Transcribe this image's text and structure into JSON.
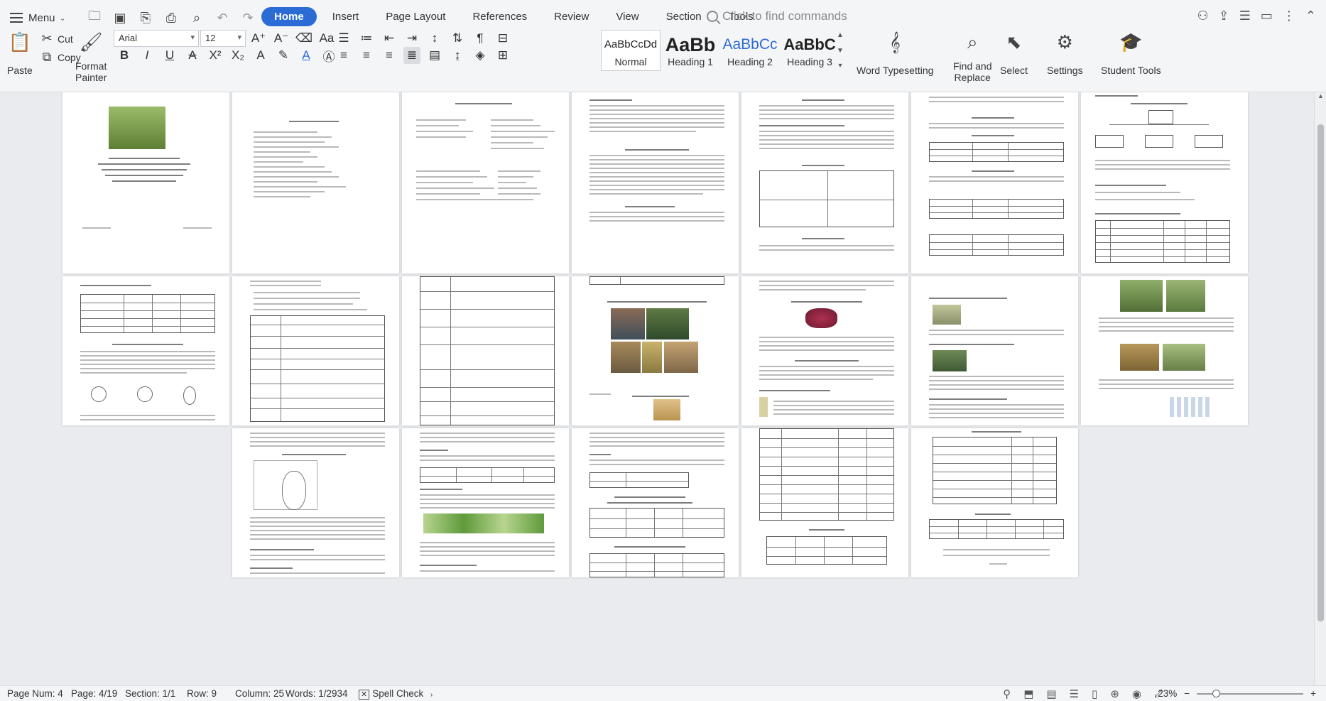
{
  "menu": {
    "label": "Menu"
  },
  "tabs": [
    {
      "label": "Home",
      "active": true
    },
    {
      "label": "Insert"
    },
    {
      "label": "Page Layout"
    },
    {
      "label": "References"
    },
    {
      "label": "Review"
    },
    {
      "label": "View"
    },
    {
      "label": "Section"
    },
    {
      "label": "Tools"
    }
  ],
  "command_search": {
    "placeholder": "Click to find commands"
  },
  "ribbon": {
    "paste": "Paste",
    "cut": "Cut",
    "copy": "Copy",
    "format_painter_1": "Format",
    "format_painter_2": "Painter",
    "font_name": "Arial",
    "font_size": "12",
    "styles": [
      {
        "sample": "AaBbCcDd",
        "name": "Normal"
      },
      {
        "sample": "AaBb",
        "name": "Heading 1"
      },
      {
        "sample": "AaBbCc",
        "name": "Heading 2"
      },
      {
        "sample": "AaBbC",
        "name": "Heading 3"
      }
    ],
    "word_typesetting": "Word Typesetting",
    "find_replace_1": "Find and",
    "find_replace_2": "Replace",
    "select": "Select",
    "settings": "Settings",
    "student_tools": "Student Tools"
  },
  "status": {
    "page_num": "Page Num: 4",
    "page": "Page: 4/19",
    "section": "Section: 1/1",
    "row": "Row: 9",
    "column": "Column: 25",
    "words": "Words: 1/2934",
    "spell_check": "Spell Check",
    "zoom": "23%"
  },
  "colors": {
    "accent": "#2b6bd6",
    "heading2": "#2b6bd6"
  }
}
